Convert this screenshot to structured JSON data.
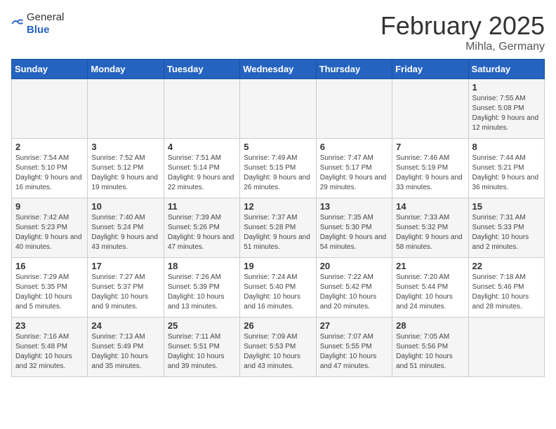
{
  "logo": {
    "text_general": "General",
    "text_blue": "Blue"
  },
  "title": "February 2025",
  "subtitle": "Mihla, Germany",
  "days_header": [
    "Sunday",
    "Monday",
    "Tuesday",
    "Wednesday",
    "Thursday",
    "Friday",
    "Saturday"
  ],
  "weeks": [
    [
      {
        "day": "",
        "info": ""
      },
      {
        "day": "",
        "info": ""
      },
      {
        "day": "",
        "info": ""
      },
      {
        "day": "",
        "info": ""
      },
      {
        "day": "",
        "info": ""
      },
      {
        "day": "",
        "info": ""
      },
      {
        "day": "1",
        "info": "Sunrise: 7:55 AM\nSunset: 5:08 PM\nDaylight: 9 hours and 12 minutes."
      }
    ],
    [
      {
        "day": "2",
        "info": "Sunrise: 7:54 AM\nSunset: 5:10 PM\nDaylight: 9 hours and 16 minutes."
      },
      {
        "day": "3",
        "info": "Sunrise: 7:52 AM\nSunset: 5:12 PM\nDaylight: 9 hours and 19 minutes."
      },
      {
        "day": "4",
        "info": "Sunrise: 7:51 AM\nSunset: 5:14 PM\nDaylight: 9 hours and 22 minutes."
      },
      {
        "day": "5",
        "info": "Sunrise: 7:49 AM\nSunset: 5:15 PM\nDaylight: 9 hours and 26 minutes."
      },
      {
        "day": "6",
        "info": "Sunrise: 7:47 AM\nSunset: 5:17 PM\nDaylight: 9 hours and 29 minutes."
      },
      {
        "day": "7",
        "info": "Sunrise: 7:46 AM\nSunset: 5:19 PM\nDaylight: 9 hours and 33 minutes."
      },
      {
        "day": "8",
        "info": "Sunrise: 7:44 AM\nSunset: 5:21 PM\nDaylight: 9 hours and 36 minutes."
      }
    ],
    [
      {
        "day": "9",
        "info": "Sunrise: 7:42 AM\nSunset: 5:23 PM\nDaylight: 9 hours and 40 minutes."
      },
      {
        "day": "10",
        "info": "Sunrise: 7:40 AM\nSunset: 5:24 PM\nDaylight: 9 hours and 43 minutes."
      },
      {
        "day": "11",
        "info": "Sunrise: 7:39 AM\nSunset: 5:26 PM\nDaylight: 9 hours and 47 minutes."
      },
      {
        "day": "12",
        "info": "Sunrise: 7:37 AM\nSunset: 5:28 PM\nDaylight: 9 hours and 51 minutes."
      },
      {
        "day": "13",
        "info": "Sunrise: 7:35 AM\nSunset: 5:30 PM\nDaylight: 9 hours and 54 minutes."
      },
      {
        "day": "14",
        "info": "Sunrise: 7:33 AM\nSunset: 5:32 PM\nDaylight: 9 hours and 58 minutes."
      },
      {
        "day": "15",
        "info": "Sunrise: 7:31 AM\nSunset: 5:33 PM\nDaylight: 10 hours and 2 minutes."
      }
    ],
    [
      {
        "day": "16",
        "info": "Sunrise: 7:29 AM\nSunset: 5:35 PM\nDaylight: 10 hours and 5 minutes."
      },
      {
        "day": "17",
        "info": "Sunrise: 7:27 AM\nSunset: 5:37 PM\nDaylight: 10 hours and 9 minutes."
      },
      {
        "day": "18",
        "info": "Sunrise: 7:26 AM\nSunset: 5:39 PM\nDaylight: 10 hours and 13 minutes."
      },
      {
        "day": "19",
        "info": "Sunrise: 7:24 AM\nSunset: 5:40 PM\nDaylight: 10 hours and 16 minutes."
      },
      {
        "day": "20",
        "info": "Sunrise: 7:22 AM\nSunset: 5:42 PM\nDaylight: 10 hours and 20 minutes."
      },
      {
        "day": "21",
        "info": "Sunrise: 7:20 AM\nSunset: 5:44 PM\nDaylight: 10 hours and 24 minutes."
      },
      {
        "day": "22",
        "info": "Sunrise: 7:18 AM\nSunset: 5:46 PM\nDaylight: 10 hours and 28 minutes."
      }
    ],
    [
      {
        "day": "23",
        "info": "Sunrise: 7:16 AM\nSunset: 5:48 PM\nDaylight: 10 hours and 32 minutes."
      },
      {
        "day": "24",
        "info": "Sunrise: 7:13 AM\nSunset: 5:49 PM\nDaylight: 10 hours and 35 minutes."
      },
      {
        "day": "25",
        "info": "Sunrise: 7:11 AM\nSunset: 5:51 PM\nDaylight: 10 hours and 39 minutes."
      },
      {
        "day": "26",
        "info": "Sunrise: 7:09 AM\nSunset: 5:53 PM\nDaylight: 10 hours and 43 minutes."
      },
      {
        "day": "27",
        "info": "Sunrise: 7:07 AM\nSunset: 5:55 PM\nDaylight: 10 hours and 47 minutes."
      },
      {
        "day": "28",
        "info": "Sunrise: 7:05 AM\nSunset: 5:56 PM\nDaylight: 10 hours and 51 minutes."
      },
      {
        "day": "",
        "info": ""
      }
    ]
  ]
}
